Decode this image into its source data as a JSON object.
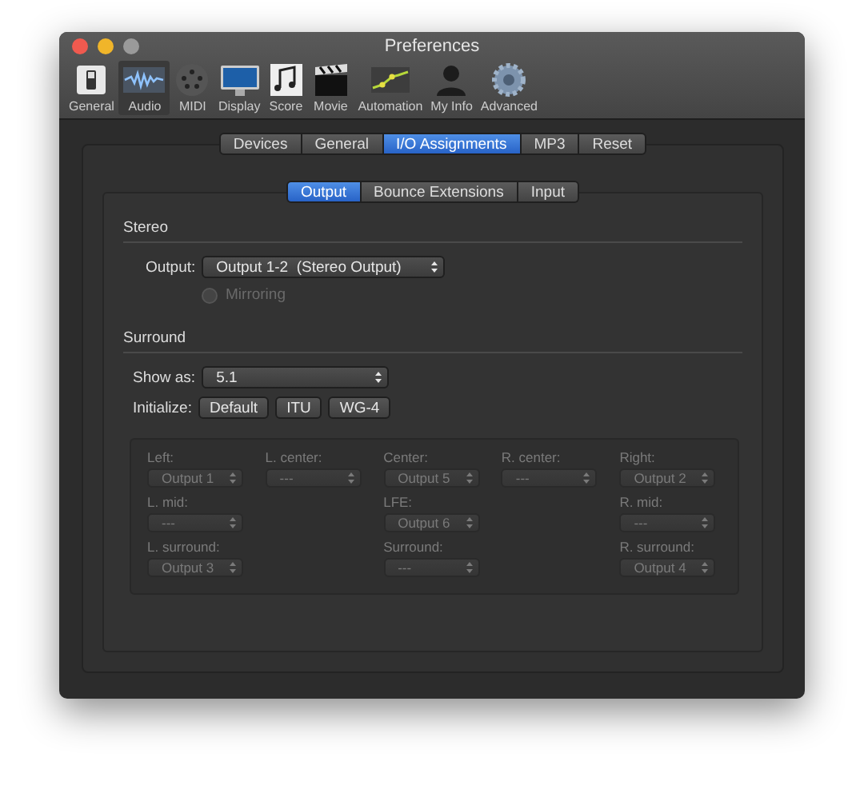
{
  "window": {
    "title": "Preferences"
  },
  "toolbar": [
    {
      "label": "General",
      "selected": false
    },
    {
      "label": "Audio",
      "selected": true
    },
    {
      "label": "MIDI",
      "selected": false
    },
    {
      "label": "Display",
      "selected": false
    },
    {
      "label": "Score",
      "selected": false
    },
    {
      "label": "Movie",
      "selected": false
    },
    {
      "label": "Automation",
      "selected": false
    },
    {
      "label": "My Info",
      "selected": false
    },
    {
      "label": "Advanced",
      "selected": false
    }
  ],
  "tabs": [
    {
      "label": "Devices",
      "selected": false
    },
    {
      "label": "General",
      "selected": false
    },
    {
      "label": "I/O Assignments",
      "selected": true
    },
    {
      "label": "MP3",
      "selected": false
    },
    {
      "label": "Reset",
      "selected": false
    }
  ],
  "subtabs": [
    {
      "label": "Output",
      "selected": true
    },
    {
      "label": "Bounce Extensions",
      "selected": false
    },
    {
      "label": "Input",
      "selected": false
    }
  ],
  "stereo": {
    "title": "Stereo",
    "output_label": "Output:",
    "output_value": "Output 1-2  (Stereo Output)",
    "mirroring": {
      "label": "Mirroring",
      "checked": false,
      "disabled": true
    }
  },
  "surround": {
    "title": "Surround",
    "show_as_label": "Show as:",
    "show_as_value": "5.1",
    "initialize_label": "Initialize:",
    "initialize_buttons": [
      "Default",
      "ITU",
      "WG-4"
    ],
    "speakers": {
      "disabled": true,
      "rows": [
        {
          "cells": [
            {
              "kind": "popup",
              "label": "Left:",
              "value": "Output 1"
            },
            {
              "kind": "popup",
              "label": "L. center:",
              "value": "---"
            },
            {
              "kind": "popup",
              "label": "Center:",
              "value": "Output 5"
            },
            {
              "kind": "popup",
              "label": "R. center:",
              "value": "---"
            },
            {
              "kind": "popup",
              "label": "Right:",
              "value": "Output 2"
            }
          ]
        },
        {
          "cells": [
            {
              "kind": "popup",
              "label": "L. mid:",
              "value": "---"
            },
            {
              "kind": "empty"
            },
            {
              "kind": "popup",
              "label": "LFE:",
              "value": "Output 6"
            },
            {
              "kind": "empty"
            },
            {
              "kind": "popup",
              "label": "R. mid:",
              "value": "---"
            }
          ]
        },
        {
          "cells": [
            {
              "kind": "popup",
              "label": "L. surround:",
              "value": "Output 3"
            },
            {
              "kind": "empty"
            },
            {
              "kind": "popup",
              "label": "Surround:",
              "value": "---"
            },
            {
              "kind": "empty"
            },
            {
              "kind": "popup",
              "label": "R. surround:",
              "value": "Output 4"
            }
          ]
        }
      ]
    }
  }
}
